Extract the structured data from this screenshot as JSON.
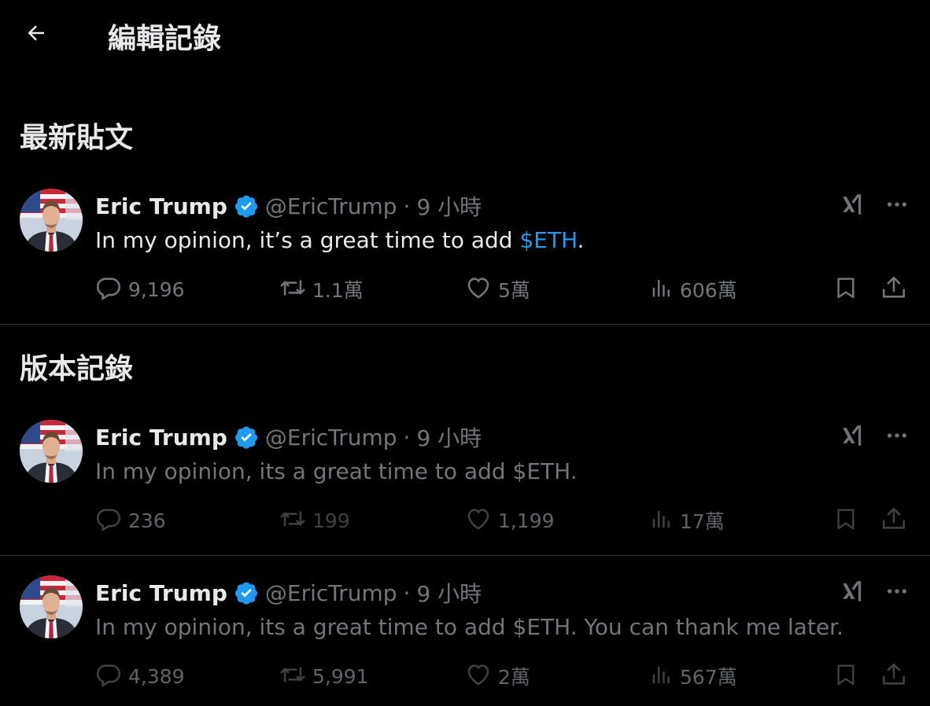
{
  "header": {
    "title": "編輯記錄",
    "back_icon": "arrow-left-icon"
  },
  "sections": {
    "latest": "最新貼文",
    "history": "版本記錄"
  },
  "colors": {
    "background": "#000000",
    "text": "#e7e9ea",
    "muted": "#71767b",
    "accent": "#1d9bf0",
    "divider": "#2f3336"
  },
  "posts": [
    {
      "author": "Eric Trump",
      "handle": "@EricTrump",
      "dot": "·",
      "time": "9 小時",
      "text_before": "In my opinion, it’s a great time to add ",
      "cashtag": "$ETH",
      "text_after": ".",
      "replies": "9,196",
      "reposts": "1.1萬",
      "likes": "5萬",
      "views": "606萬"
    },
    {
      "author": "Eric Trump",
      "handle": "@EricTrump",
      "dot": "·",
      "time": "9 小時",
      "text": "In my opinion, its a great time to add $ETH.",
      "replies": "236",
      "reposts": "199",
      "likes": "1,199",
      "views": "17萬"
    },
    {
      "author": "Eric Trump",
      "handle": "@EricTrump",
      "dot": "·",
      "time": "9 小時",
      "text": "In my opinion, its a great time to add $ETH. You can thank me later.",
      "replies": "4,389",
      "reposts": "5,991",
      "likes": "2萬",
      "views": "567萬"
    }
  ]
}
